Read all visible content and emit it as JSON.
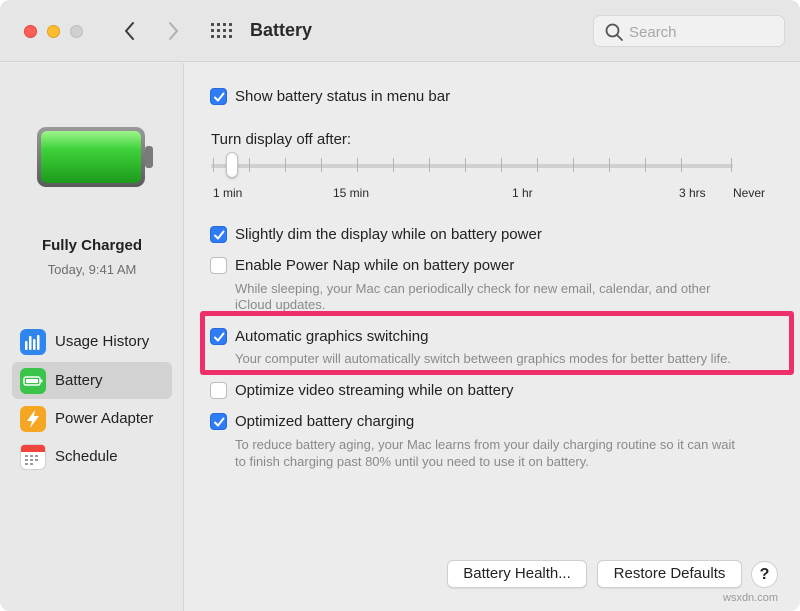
{
  "window": {
    "title": "Battery"
  },
  "search": {
    "placeholder": "Search"
  },
  "sidebar": {
    "status": "Fully Charged",
    "time": "Today, 9:41 AM",
    "items": [
      {
        "label": "Usage History",
        "icon": "usage-history-icon",
        "selected": false
      },
      {
        "label": "Battery",
        "icon": "battery-icon",
        "selected": true
      },
      {
        "label": "Power Adapter",
        "icon": "power-adapter-icon",
        "selected": false
      },
      {
        "label": "Schedule",
        "icon": "schedule-icon",
        "selected": false
      }
    ]
  },
  "options": {
    "show_status": {
      "label": "Show battery status in menu bar",
      "checked": true
    },
    "display_off": {
      "label": "Turn display off after:",
      "ticks": [
        "1 min",
        "15 min",
        "1 hr",
        "3 hrs",
        "Never"
      ],
      "selected": "2 min"
    },
    "dim_display": {
      "label": "Slightly dim the display while on battery power",
      "checked": true
    },
    "power_nap": {
      "label": "Enable Power Nap while on battery power",
      "checked": false,
      "desc1": "While sleeping, your Mac can periodically check for new email, calendar, and other",
      "desc2": "iCloud updates."
    },
    "graphics_switching": {
      "label": "Automatic graphics switching",
      "checked": true,
      "desc": "Your computer will automatically switch between graphics modes for better battery life."
    },
    "video_streaming": {
      "label": "Optimize video streaming while on battery",
      "checked": false
    },
    "optimized_charging": {
      "label": "Optimized battery charging",
      "checked": true,
      "desc1": "To reduce battery aging, your Mac learns from your daily charging routine so it can wait",
      "desc2": "to finish charging past 80% until you need to use it on battery."
    }
  },
  "buttons": {
    "battery_health": "Battery Health...",
    "restore_defaults": "Restore Defaults",
    "help": "?"
  },
  "watermark": "wsxdn.com",
  "colors": {
    "accent": "#2e7cf6",
    "highlight": "#ee2f6a",
    "battery_green": "#3fd23b"
  }
}
